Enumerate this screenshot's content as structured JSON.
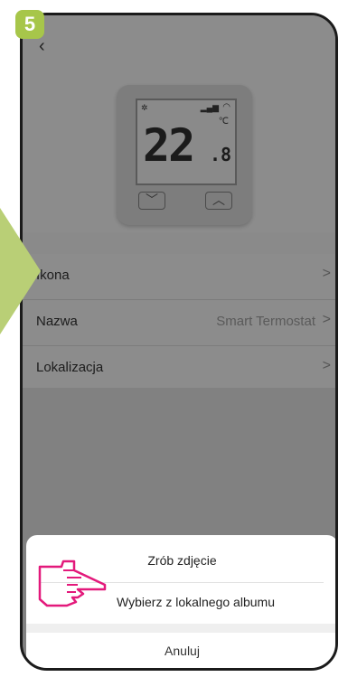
{
  "step_badge": "5",
  "nav": {
    "back_icon": "‹"
  },
  "device": {
    "temperature_int": "22",
    "temperature_dec": ".8",
    "unit": "℃",
    "fan_icon": "fan-icon",
    "signal_icon": "signal-icon",
    "wifi_icon": "wifi-icon",
    "down_button": "﹀",
    "up_button": "︿"
  },
  "settings": [
    {
      "label": "Ikona",
      "value": "",
      "chevron": ">"
    },
    {
      "label": "Nazwa",
      "value": "Smart Termostat",
      "chevron": ">"
    },
    {
      "label": "Lokalizacja",
      "value": "",
      "chevron": ">"
    }
  ],
  "action_sheet": {
    "take_photo": "Zrób zdjęcie",
    "choose_album": "Wybierz z lokalnego albumu",
    "cancel": "Anuluj"
  },
  "colors": {
    "accent_badge": "#a7c64a",
    "pointer_hand": "#e3197b",
    "overlay": "#8c8c8c"
  }
}
